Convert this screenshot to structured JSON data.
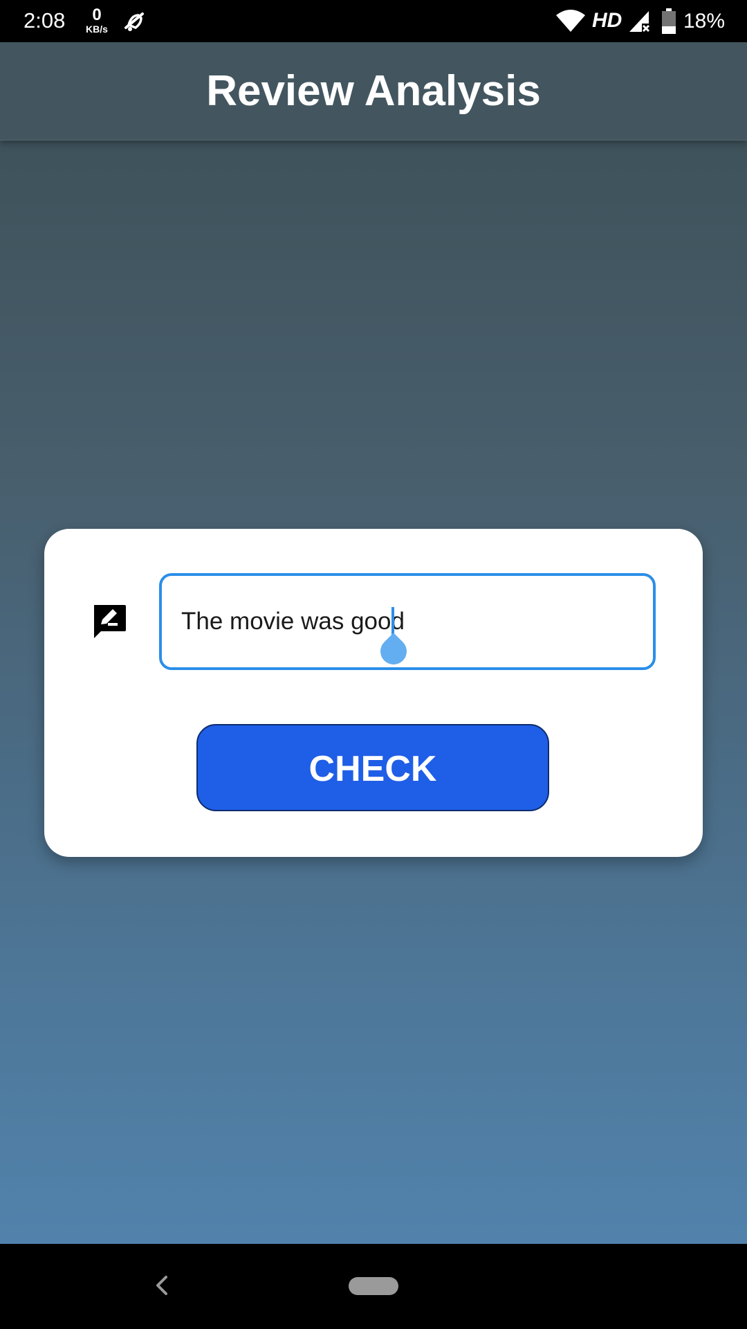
{
  "status_bar": {
    "time": "2:08",
    "net_speed_value": "0",
    "net_speed_unit": "KB/s",
    "network_type": "HD",
    "battery_percent": "18%"
  },
  "app_bar": {
    "title": "Review Analysis"
  },
  "review_form": {
    "input_value": "The movie was good",
    "icon": "rate-review-icon",
    "button_label": "CHECK"
  },
  "nav_bar": {
    "back_icon": "back-chevron-icon",
    "home_icon": "home-pill-icon"
  },
  "colors": {
    "accent_field": "#2b8ee8",
    "button": "#1f5ee6",
    "app_bar": "#435660",
    "gradient_top": "#3f535c",
    "gradient_bottom": "#5386b2"
  }
}
